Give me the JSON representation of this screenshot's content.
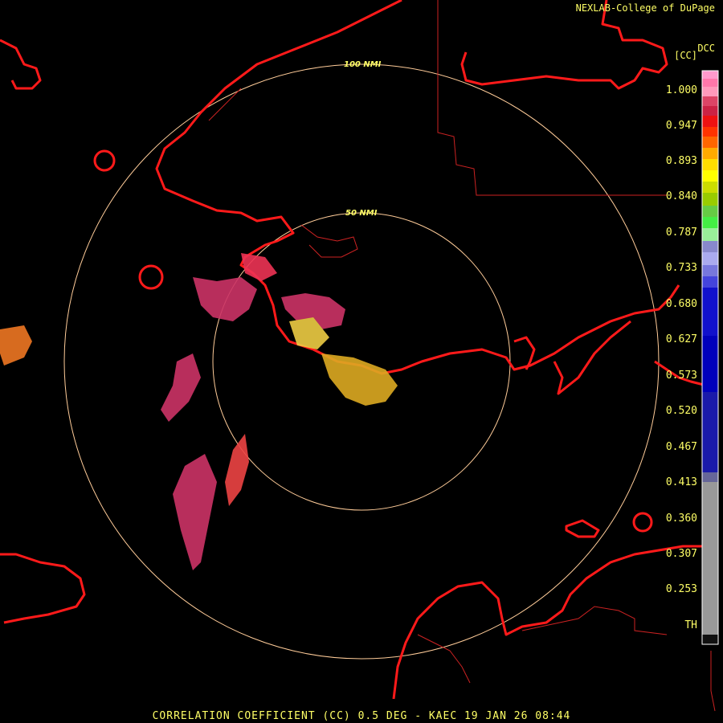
{
  "credit": "NEXLAB-College of DuPage",
  "product_code": "DCC",
  "unit": "[CC]",
  "title": "CORRELATION COEFFICIENT (CC) 0.5 DEG - KAEC 19 JAN 26 08:44",
  "rings": [
    {
      "label": "100 NMI"
    },
    {
      "label": "50 NMI"
    }
  ],
  "legend": {
    "labels": [
      "1.000",
      "0.947",
      "0.893",
      "0.840",
      "0.787",
      "0.733",
      "0.680",
      "0.627",
      "0.573",
      "0.520",
      "0.467",
      "0.413",
      "0.360",
      "0.307",
      "0.253",
      "TH"
    ]
  },
  "colors": {
    "coastline": "#ff1a1a",
    "border": "#cc2222",
    "ring": "#ffcc99",
    "text": "#ffff66"
  }
}
